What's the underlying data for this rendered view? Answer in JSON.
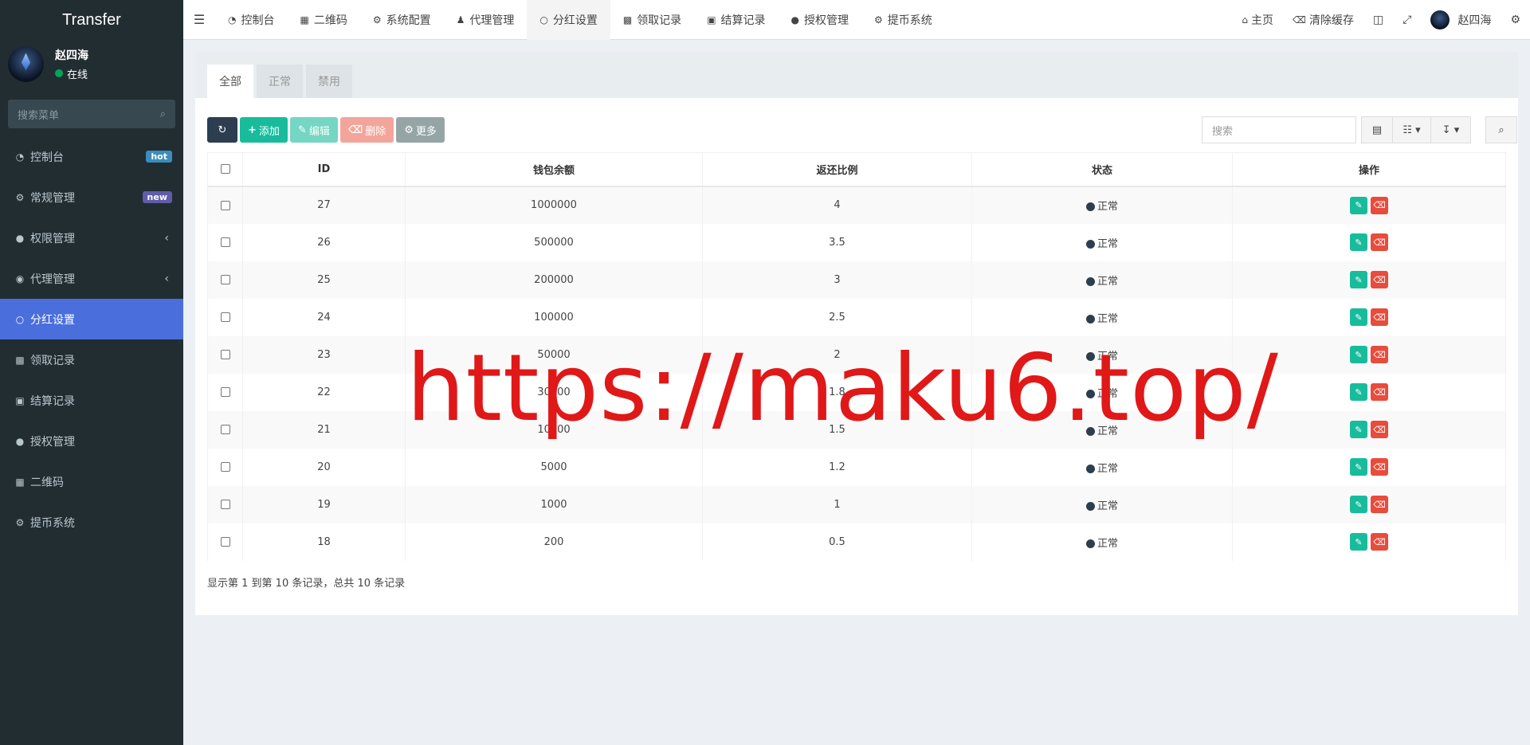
{
  "brand": "Transfer",
  "user": {
    "name": "赵四海",
    "status": "在线"
  },
  "sidebar": {
    "search_placeholder": "搜索菜单",
    "items": [
      {
        "label": "控制台",
        "icon": "dashboard-icon",
        "badge": "hot"
      },
      {
        "label": "常规管理",
        "icon": "cogs-icon",
        "badge": "new"
      },
      {
        "label": "权限管理",
        "icon": "group-icon",
        "chevron": "‹"
      },
      {
        "label": "代理管理",
        "icon": "user-circle-icon",
        "chevron": "‹"
      },
      {
        "label": "分红设置",
        "icon": "circle-icon",
        "active": true
      },
      {
        "label": "领取记录",
        "icon": "users-icon"
      },
      {
        "label": "结算记录",
        "icon": "settlement-icon"
      },
      {
        "label": "授权管理",
        "icon": "group-icon"
      },
      {
        "label": "二维码",
        "icon": "qrcode-icon"
      },
      {
        "label": "提币系统",
        "icon": "gear-icon"
      }
    ]
  },
  "topnav": {
    "items": [
      {
        "label": "控制台",
        "icon": "dashboard-icon"
      },
      {
        "label": "二维码",
        "icon": "qrcode-icon"
      },
      {
        "label": "系统配置",
        "icon": "gear-icon"
      },
      {
        "label": "代理管理",
        "icon": "user-icon"
      },
      {
        "label": "分红设置",
        "icon": "circle-icon",
        "active": true
      },
      {
        "label": "领取记录",
        "icon": "users-icon"
      },
      {
        "label": "结算记录",
        "icon": "settlement-icon"
      },
      {
        "label": "授权管理",
        "icon": "group-icon"
      },
      {
        "label": "提币系统",
        "icon": "gear-icon"
      }
    ],
    "right": {
      "home": "主页",
      "clear_cache": "清除缓存",
      "user_name": "赵四海"
    }
  },
  "tabs": [
    "全部",
    "正常",
    "禁用"
  ],
  "toolbar": {
    "add": "添加",
    "edit": "编辑",
    "delete": "删除",
    "more": "更多",
    "search_placeholder": "搜索"
  },
  "table": {
    "columns": [
      "ID",
      "钱包余额",
      "返还比例",
      "状态",
      "操作"
    ],
    "rows": [
      {
        "id": "27",
        "balance": "1000000",
        "ratio": "4",
        "status": "正常"
      },
      {
        "id": "26",
        "balance": "500000",
        "ratio": "3.5",
        "status": "正常"
      },
      {
        "id": "25",
        "balance": "200000",
        "ratio": "3",
        "status": "正常"
      },
      {
        "id": "24",
        "balance": "100000",
        "ratio": "2.5",
        "status": "正常"
      },
      {
        "id": "23",
        "balance": "50000",
        "ratio": "2",
        "status": "正常"
      },
      {
        "id": "22",
        "balance": "30000",
        "ratio": "1.8",
        "status": "正常"
      },
      {
        "id": "21",
        "balance": "10000",
        "ratio": "1.5",
        "status": "正常"
      },
      {
        "id": "20",
        "balance": "5000",
        "ratio": "1.2",
        "status": "正常"
      },
      {
        "id": "19",
        "balance": "1000",
        "ratio": "1",
        "status": "正常"
      },
      {
        "id": "18",
        "balance": "200",
        "ratio": "0.5",
        "status": "正常"
      }
    ]
  },
  "pagination": "显示第 1 到第 10 条记录，总共 10 条记录",
  "watermark": "https://maku6.top/",
  "colors": {
    "sidebar_bg": "#222d32",
    "active_menu": "#4a6fdc",
    "success": "#18bc9c",
    "danger": "#e74c3c",
    "watermark": "#e01818"
  }
}
